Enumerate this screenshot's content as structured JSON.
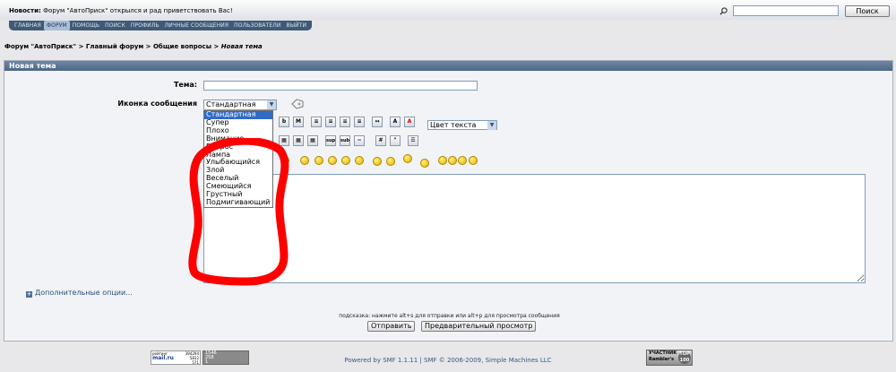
{
  "news": {
    "label": "Новости:",
    "text": "Форум \"АвтоПриcк\" открылся и рад приветствовать Вас!"
  },
  "search": {
    "placeholder": "",
    "button": "Поиск"
  },
  "nav": [
    "ГЛАВНАЯ",
    "ФОРУМ",
    "ПОМОЩЬ",
    "ПОИСК",
    "ПРОФИЛЬ",
    "ЛИЧНЫЕ СООБЩЕНИЯ",
    "ПОЛЬЗОВАТЕЛИ",
    "ВЫЙТИ"
  ],
  "breadcrumb": {
    "forum": "Форум \"АвтоПриcк\"",
    "sep": ">",
    "main": "Главный форум",
    "general": "Общие вопросы",
    "current": "Новая тема"
  },
  "panel": {
    "title": "Новая тема"
  },
  "form": {
    "subject_label": "Тема:",
    "icon_label": "Иконка сообщения",
    "icon_selected": "Стандартная",
    "icon_options": [
      "Стандартная",
      "Супер",
      "Плохо",
      "Внимание",
      "Вопрос",
      "Лампа",
      "Улыбающийся",
      "Злой",
      "Веселый",
      "Смеющийся",
      "Грустный",
      "Подмигивающий"
    ],
    "color_select": "Цвет текста"
  },
  "more_options": "Дополнительные опции...",
  "hint": "подсказка: нажмите alt+s для отправки или alt+p для просмотра сообщения",
  "buttons": {
    "submit": "Отправить",
    "preview": "Предварительный просмотр"
  },
  "footer": {
    "powered": "Powered by SMF 1.1.11 | SMF © 2006-2009, Simple Machines LLC",
    "counter": {
      "label": "рейтинг",
      "brand": "mail.ru",
      "n1": "394294",
      "n2": "5832",
      "n3": "571"
    },
    "counter2": {
      "n1": "1546",
      "n2": "258",
      "n3": "1"
    },
    "rambler": {
      "line1": "УЧАСТНИК",
      "line2": "Rambler's",
      "badge": "TOP 100"
    }
  },
  "colors": {
    "accent": "#3f5a78",
    "highlight": "#316ac5",
    "scribble": "#ff0000"
  }
}
